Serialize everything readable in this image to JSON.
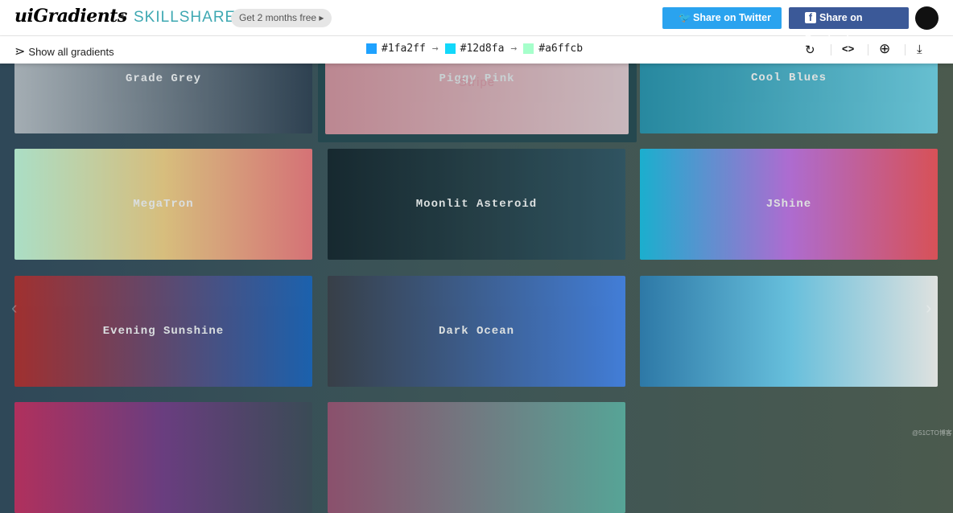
{
  "header": {
    "logo": "uiGradients",
    "plus": "+",
    "partner": "SKILLSHARE",
    "promo": "Get 2 months free ▸",
    "twitter": "Share on Twitter",
    "facebook": "Share on Facebook"
  },
  "toolbar": {
    "show_all": "Show all gradients",
    "colors": [
      {
        "hex": "#1fa2ff"
      },
      {
        "hex": "#12d8fa"
      },
      {
        "hex": "#a6ffcb"
      }
    ],
    "arrow": "→",
    "icons": [
      "rotate-icon",
      "code-icon",
      "add-icon",
      "download-icon"
    ]
  },
  "gradients": [
    {
      "name": "Grade Grey",
      "colors": [
        "#bdc3c7",
        "#2c3e50"
      ]
    },
    {
      "name": "Piggy Pink",
      "overlay": "Stripe",
      "colors": [
        "#ee9ca7",
        "#ffdde1"
      ]
    },
    {
      "name": "Cool Blues",
      "colors": [
        "#2193b0",
        "#6dd5ed"
      ]
    },
    {
      "name": "MegaTron",
      "colors": [
        "#c6ffdd",
        "#fbd786",
        "#f7797d"
      ]
    },
    {
      "name": "Moonlit Asteroid",
      "colors": [
        "#0f2027",
        "#203a43",
        "#2c5364"
      ]
    },
    {
      "name": "JShine",
      "colors": [
        "#12c2e9",
        "#c471ed",
        "#f64f59"
      ]
    },
    {
      "name": "Evening Sunshine",
      "colors": [
        "#b92b27",
        "#1565c0"
      ]
    },
    {
      "name": "Dark Ocean",
      "colors": [
        "#373b44",
        "#4286f4"
      ]
    },
    {
      "name": "",
      "colors": [
        "#2980b9",
        "#6dd5fa",
        "#ffffff"
      ]
    },
    {
      "name": "",
      "colors": [
        "#cc2b5e",
        "#753a88",
        "#3a4a55"
      ]
    },
    {
      "name": "",
      "colors": [
        "#9d5071",
        "#5bb5a5"
      ]
    }
  ],
  "nav": {
    "prev": "‹",
    "next": "›"
  },
  "watermark": "@51CTO博客"
}
